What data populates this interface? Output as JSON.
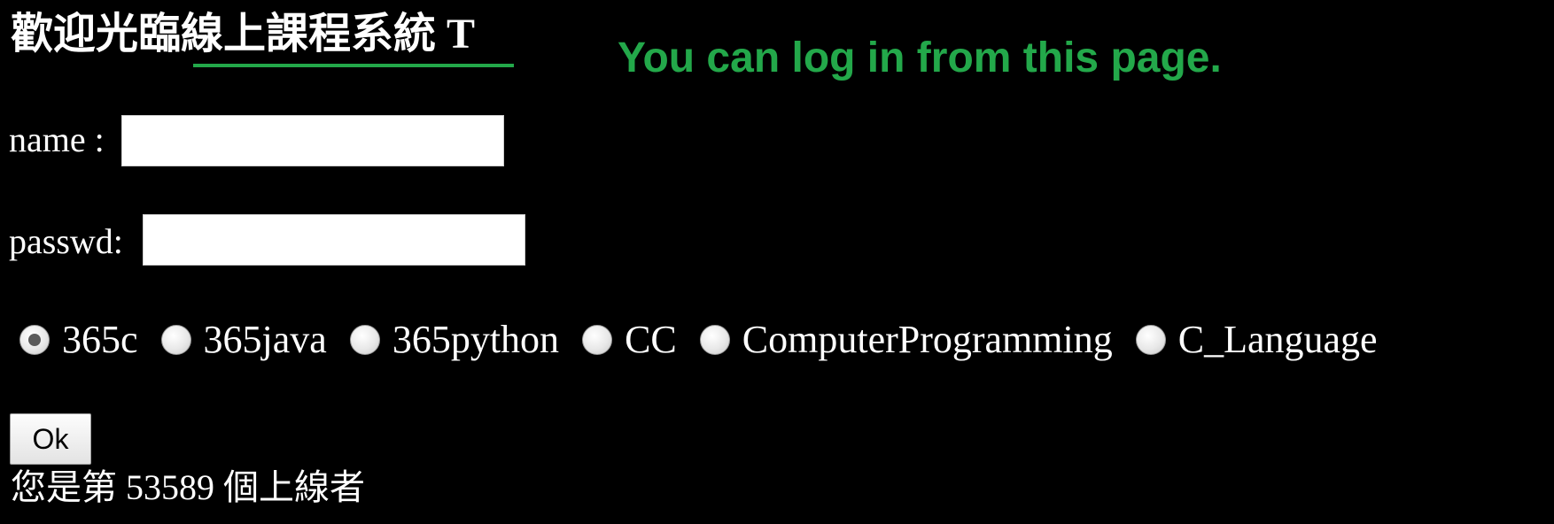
{
  "header": {
    "title": "歡迎光臨線上課程系統 T",
    "accent_color": "#23a84a"
  },
  "login_note": "You can log in from this page.",
  "form": {
    "name_label": "name :",
    "name_value": "",
    "passwd_label": "passwd:",
    "passwd_value": "",
    "courses": [
      {
        "label": "365c",
        "checked": true
      },
      {
        "label": "365java",
        "checked": false
      },
      {
        "label": "365python",
        "checked": false
      },
      {
        "label": "CC",
        "checked": false
      },
      {
        "label": "ComputerProgramming",
        "checked": false
      },
      {
        "label": "C_Language",
        "checked": false
      }
    ],
    "ok_label": "Ok"
  },
  "visitor": {
    "prefix": "您是第",
    "count": "53589",
    "suffix": "個上線者"
  }
}
